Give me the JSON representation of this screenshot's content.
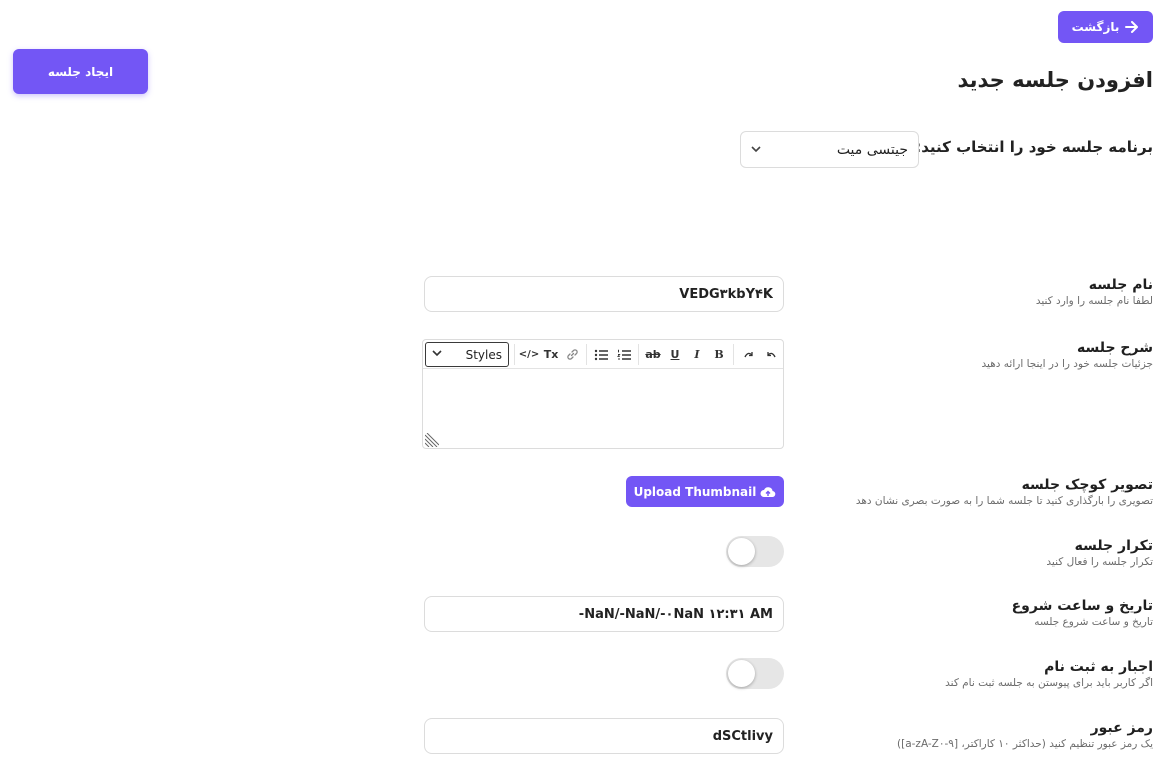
{
  "header": {
    "back_label": "بازگشت",
    "create_label": "ایجاد جلسه",
    "title": "افزودن جلسه جدید"
  },
  "platform": {
    "label": "برنامه جلسه خود را انتخاب کنید:",
    "selected": "جیتسی میت"
  },
  "fields": {
    "name": {
      "title": "نام جلسه",
      "subtitle": "لطفا نام جلسه را وارد کنید",
      "value": "VEDG۳kbY۴K"
    },
    "description": {
      "title": "شرح جلسه",
      "subtitle": "جزئیات جلسه خود را در اینجا ارائه دهید"
    },
    "thumbnail": {
      "title": "تصویر کوچک جلسه",
      "subtitle": "تصویری را بارگذاری کنید تا جلسه شما را به صورت بصری نشان دهد",
      "button_label": "Upload Thumbnail"
    },
    "repeat": {
      "title": "تکرار جلسه",
      "subtitle": "تکرار جلسه را فعال کنید",
      "enabled": false
    },
    "start": {
      "title": "تاریخ و ساعت شروع",
      "subtitle": "تاریخ و ساعت شروع جلسه",
      "value": "NaN/-NaN/-۰NaN ۱۲:۳۱ AM-"
    },
    "require_registration": {
      "title": "اجبار به ثبت نام",
      "subtitle": "اگر کاربر باید برای پیوستن به جلسه ثبت نام کند",
      "enabled": false
    },
    "password": {
      "title": "رمز عبور",
      "subtitle": "یک رمز عبور تنظیم کنید (حداکثر ۱۰ کاراکتر، [a-zA-Z۰-۹])",
      "value": "dSCtlivy"
    }
  },
  "editor": {
    "styles_label": "Styles",
    "toolbar_glyphs": {
      "code": "</>",
      "clear_format": "Tx",
      "bold": "B",
      "italic": "I",
      "underline": "U",
      "strike": "ab"
    }
  },
  "colors": {
    "accent": "#7356f5",
    "toggle_off": "#e6e6e6"
  }
}
